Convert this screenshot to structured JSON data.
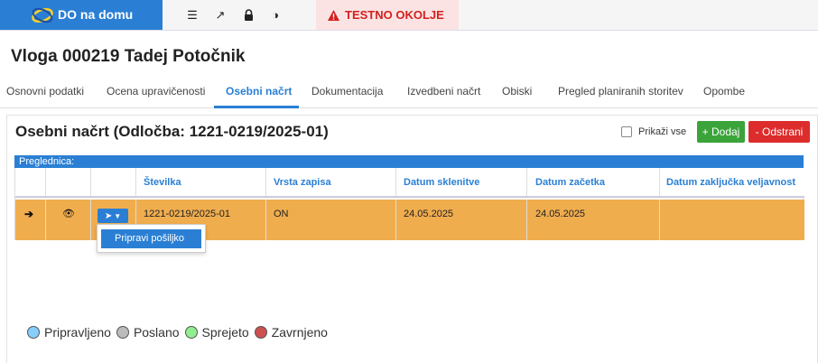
{
  "app": {
    "brand": "DO na domu",
    "environment_warning": "TESTNO OKOLJE",
    "toolbar_icons": [
      "list-icon",
      "external-link-icon",
      "lock-icon",
      "contrast-icon"
    ]
  },
  "page": {
    "title": "Vloga 000219 Tadej Potočnik"
  },
  "tabs": [
    {
      "label": "Osnovni podatki",
      "active": false
    },
    {
      "label": "Ocena upravičenosti",
      "active": false
    },
    {
      "label": "Osebni načrt",
      "active": true
    },
    {
      "label": "Dokumentacija",
      "active": false
    },
    {
      "label": "Izvedbeni načrt",
      "active": false
    },
    {
      "label": "Obiski",
      "active": false
    },
    {
      "label": "Pregled planiranih storitev",
      "active": false
    },
    {
      "label": "Opombe",
      "active": false
    }
  ],
  "panel": {
    "title": "Osebni načrt (Odločba: 1221-0219/2025-01)",
    "show_all_label": "Prikaži vse",
    "add_label": "+ Dodaj",
    "remove_label": "- Odstrani"
  },
  "grid": {
    "caption": "Preglednica:",
    "columns": [
      "Številka",
      "Vrsta zapisa",
      "Datum sklenitve",
      "Datum začetka",
      "Datum zaključka veljavnost"
    ],
    "rows": [
      {
        "stevilka": "1221-0219/2025-01",
        "vrsta": "ON",
        "sklenitev": "24.05.2025",
        "zacetek": "24.05.2025",
        "zakljucek": ""
      }
    ],
    "row_highlight_color": "#f0ad4e"
  },
  "dropdown": {
    "item": "Pripravi pošiljko"
  },
  "legend": [
    {
      "label": "Pripravljeno",
      "color": "#87cefa"
    },
    {
      "label": "Poslano",
      "color": "#bbbbbb"
    },
    {
      "label": "Sprejeto",
      "color": "#90ee90"
    },
    {
      "label": "Zavrnjeno",
      "color": "#cd5050"
    }
  ],
  "colors": {
    "brand": "#2a7fd4",
    "add_button": "#3aa43a",
    "remove_button": "#dd2c2c",
    "warning_text": "#d42020"
  }
}
